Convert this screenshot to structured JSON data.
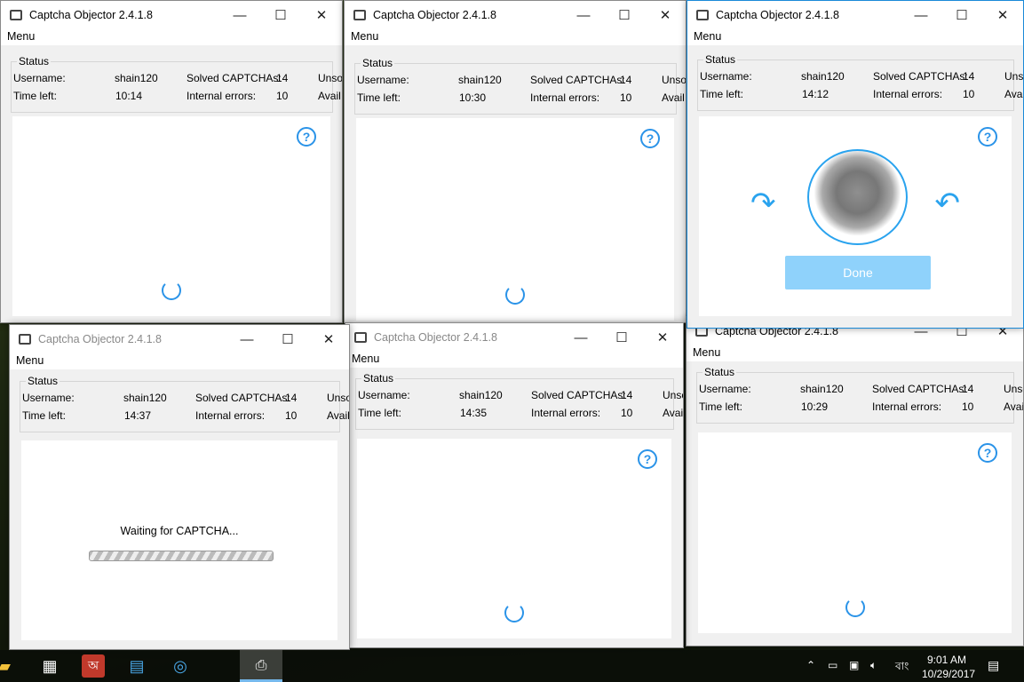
{
  "app_title": "Captcha Objector 2.4.1.8",
  "menu_label": "Menu",
  "status_label": "Status",
  "labels": {
    "username": "Username:",
    "time_left": "Time left:",
    "solved": "Solved CAPTCHAs:",
    "errors": "Internal errors:",
    "unsolved": "Unsol",
    "available": "Avail"
  },
  "windows": [
    {
      "id": "w1",
      "username": "shain120",
      "time_left": "10:14",
      "solved": "14",
      "errors": "10",
      "state": "loading"
    },
    {
      "id": "w2",
      "username": "shain120",
      "time_left": "10:30",
      "solved": "14",
      "errors": "10",
      "state": "loading"
    },
    {
      "id": "w6",
      "username": "shain120",
      "time_left": "10:29",
      "solved": "14",
      "errors": "10",
      "state": "loading"
    },
    {
      "id": "w3",
      "username": "shain120",
      "time_left": "14:12",
      "solved": "14",
      "errors": "10",
      "state": "captcha",
      "active": true
    },
    {
      "id": "w5",
      "username": "shain120",
      "time_left": "14:35",
      "solved": "14",
      "errors": "10",
      "state": "loading"
    },
    {
      "id": "w4",
      "username": "shain120",
      "time_left": "14:37",
      "solved": "14",
      "errors": "10",
      "state": "waiting"
    }
  ],
  "captcha": {
    "done_label": "Done",
    "help": "?"
  },
  "waiting": {
    "text": "Waiting for CAPTCHA..."
  },
  "taskbar": {
    "time": "9:01 AM",
    "date": "10/29/2017",
    "lang": "বাং"
  }
}
